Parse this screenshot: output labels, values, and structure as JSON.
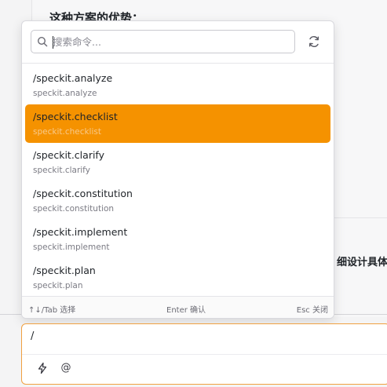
{
  "background": {
    "heading": "这种方案的优势：",
    "snippet": "细设计具体"
  },
  "palette": {
    "search": {
      "placeholder": "搜索命令...",
      "value": ""
    },
    "refresh_icon": "refresh-icon",
    "items": [
      {
        "title": "/speckit.analyze",
        "subtitle": "speckit.analyze"
      },
      {
        "title": "/speckit.checklist",
        "subtitle": "speckit.checklist"
      },
      {
        "title": "/speckit.clarify",
        "subtitle": "speckit.clarify"
      },
      {
        "title": "/speckit.constitution",
        "subtitle": "speckit.constitution"
      },
      {
        "title": "/speckit.implement",
        "subtitle": "speckit.implement"
      },
      {
        "title": "/speckit.plan",
        "subtitle": "speckit.plan"
      }
    ],
    "selected_index": 1,
    "footer": {
      "nav_hint": "↑↓/Tab 选择",
      "enter_hint": "Enter 确认",
      "esc_hint": "Esc 关闭"
    }
  },
  "composer": {
    "value": "/",
    "tools": [
      "lightning-icon",
      "at-icon"
    ],
    "at_label": "@"
  },
  "colors": {
    "accent": "#f59200",
    "composer_border": "#f0a040"
  }
}
